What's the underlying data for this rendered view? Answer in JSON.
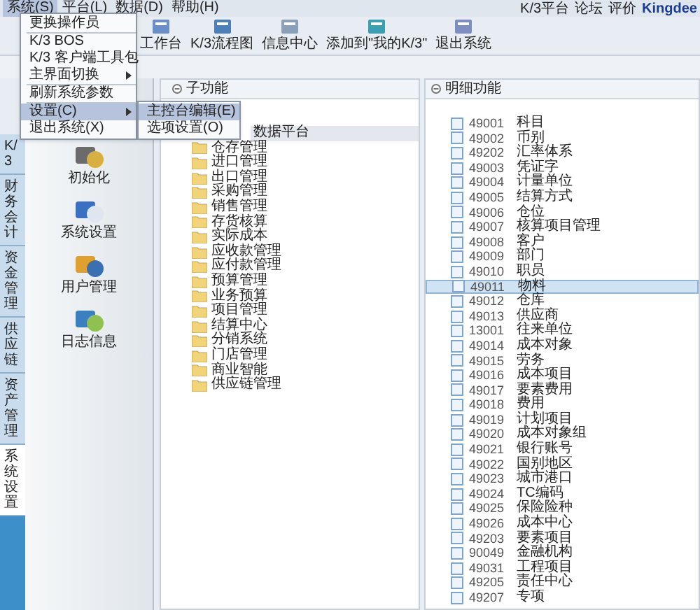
{
  "menu_bar": {
    "items": [
      {
        "label": "系统(S)",
        "selected": true
      },
      {
        "label": "平台(L)",
        "selected": false
      },
      {
        "label": "数据(D)",
        "selected": false
      },
      {
        "label": "帮助(H)",
        "selected": false
      }
    ],
    "links": [
      "K/3平台",
      "论坛",
      "评价",
      "Kingdee"
    ]
  },
  "toolbar": [
    "工作台",
    "K/3流程图",
    "信息中心",
    "添加到\"我的K/3\"",
    "退出系统"
  ],
  "system_menu": {
    "items": [
      {
        "label": "更换操作员",
        "kind": "item",
        "selected": false,
        "divider_before": false
      },
      {
        "label": "K/3 BOS",
        "kind": "item",
        "selected": false,
        "divider_before": true
      },
      {
        "label": "K/3 客户端工具包",
        "kind": "item",
        "selected": false,
        "divider_before": false
      },
      {
        "label": "主界面切换",
        "kind": "submenu",
        "selected": false,
        "divider_before": false
      },
      {
        "label": "刷新系统参数",
        "kind": "item",
        "selected": false,
        "divider_before": true
      },
      {
        "label": "设置(C)",
        "kind": "submenu",
        "selected": true,
        "divider_before": true
      },
      {
        "label": "退出系统(X)",
        "kind": "item",
        "selected": false,
        "divider_before": false
      }
    ],
    "submenu": [
      {
        "label": "主控台编辑(E)",
        "selected": true
      },
      {
        "label": "选项设置(O)",
        "selected": false
      }
    ]
  },
  "side_tabs": [
    {
      "label": "K/3",
      "selected": false
    },
    {
      "label": "财务会计",
      "selected": false
    },
    {
      "label": "资金管理",
      "selected": false
    },
    {
      "label": "供应链",
      "selected": false
    },
    {
      "label": "资产管理",
      "selected": false
    },
    {
      "label": "系统设置",
      "selected": true
    }
  ],
  "launcher": [
    "初始化",
    "系统设置",
    "用户管理",
    "日志信息"
  ],
  "sub_functions": {
    "header": "子功能",
    "items": [
      {
        "label": "数据平台",
        "selected": true
      },
      {
        "label": "仓存管理",
        "selected": false
      },
      {
        "label": "进口管理",
        "selected": false
      },
      {
        "label": "出口管理",
        "selected": false
      },
      {
        "label": "采购管理",
        "selected": false
      },
      {
        "label": "销售管理",
        "selected": false
      },
      {
        "label": "存货核算",
        "selected": false
      },
      {
        "label": "实际成本",
        "selected": false
      },
      {
        "label": "应收款管理",
        "selected": false
      },
      {
        "label": "应付款管理",
        "selected": false
      },
      {
        "label": "预算管理",
        "selected": false
      },
      {
        "label": "业务预算",
        "selected": false
      },
      {
        "label": "项目管理",
        "selected": false
      },
      {
        "label": "结算中心",
        "selected": false
      },
      {
        "label": "分销系统",
        "selected": false
      },
      {
        "label": "门店管理",
        "selected": false
      },
      {
        "label": "商业智能",
        "selected": false
      },
      {
        "label": "供应链管理",
        "selected": false
      }
    ]
  },
  "details": {
    "header": "明细功能",
    "items": [
      {
        "code": "49001",
        "name": "科目",
        "selected": false
      },
      {
        "code": "49002",
        "name": "币别",
        "selected": false
      },
      {
        "code": "49202",
        "name": "汇率体系",
        "selected": false
      },
      {
        "code": "49003",
        "name": "凭证字",
        "selected": false
      },
      {
        "code": "49004",
        "name": "计量单位",
        "selected": false
      },
      {
        "code": "49005",
        "name": "结算方式",
        "selected": false
      },
      {
        "code": "49006",
        "name": "仓位",
        "selected": false
      },
      {
        "code": "49007",
        "name": "核算项目管理",
        "selected": false
      },
      {
        "code": "49008",
        "name": "客户",
        "selected": false
      },
      {
        "code": "49009",
        "name": "部门",
        "selected": false
      },
      {
        "code": "49010",
        "name": "职员",
        "selected": false
      },
      {
        "code": "49011",
        "name": "物料",
        "selected": true
      },
      {
        "code": "49012",
        "name": "仓库",
        "selected": false
      },
      {
        "code": "49013",
        "name": "供应商",
        "selected": false
      },
      {
        "code": "13001",
        "name": "往来单位",
        "selected": false
      },
      {
        "code": "49014",
        "name": "成本对象",
        "selected": false
      },
      {
        "code": "49015",
        "name": "劳务",
        "selected": false
      },
      {
        "code": "49016",
        "name": "成本项目",
        "selected": false
      },
      {
        "code": "49017",
        "name": "要素费用",
        "selected": false
      },
      {
        "code": "49018",
        "name": "费用",
        "selected": false
      },
      {
        "code": "49019",
        "name": "计划项目",
        "selected": false
      },
      {
        "code": "49020",
        "name": "成本对象组",
        "selected": false
      },
      {
        "code": "49021",
        "name": "银行账号",
        "selected": false
      },
      {
        "code": "49022",
        "name": "国别地区",
        "selected": false
      },
      {
        "code": "49023",
        "name": "城市港口",
        "selected": false
      },
      {
        "code": "49024",
        "name": "TC编码",
        "selected": false
      },
      {
        "code": "49025",
        "name": "保险险种",
        "selected": false
      },
      {
        "code": "49026",
        "name": "成本中心",
        "selected": false
      },
      {
        "code": "49203",
        "name": "要素项目",
        "selected": false
      },
      {
        "code": "90049",
        "name": "金融机构",
        "selected": false
      },
      {
        "code": "49031",
        "name": "工程项目",
        "selected": false
      },
      {
        "code": "49205",
        "name": "责任中心",
        "selected": false
      },
      {
        "code": "49207",
        "name": "专项",
        "selected": false
      }
    ]
  }
}
